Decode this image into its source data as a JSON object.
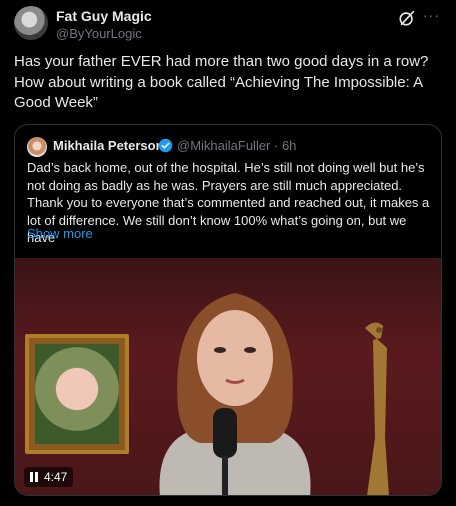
{
  "tweet": {
    "author_name": "Fat Guy Magic",
    "author_handle": "@ByYourLogic",
    "more_label": "···",
    "text": "Has your father EVER had more than two good days in a row? How about writing a book called “Achieving The Impossible: A Good Week”"
  },
  "quoted": {
    "author_name": "Mikhaila Peterson",
    "author_handle": "@MikhailaFuller · 6h",
    "text": "Dad’s back home, out of the hospital. He’s still not doing well but he’s not doing as badly as he was. Prayers are still much appreciated. Thank you to everyone that’s commented and reached out, it makes a lot of difference. We still don’t know 100% what’s going on, but we have",
    "show_more": "Show more",
    "video_time": "4:47"
  },
  "colors": {
    "background": "#000000",
    "text": "#e7e9ea",
    "muted": "#71767b",
    "link": "#1d9bf0",
    "border": "#2f3336",
    "verified": "#1d9bf0"
  }
}
